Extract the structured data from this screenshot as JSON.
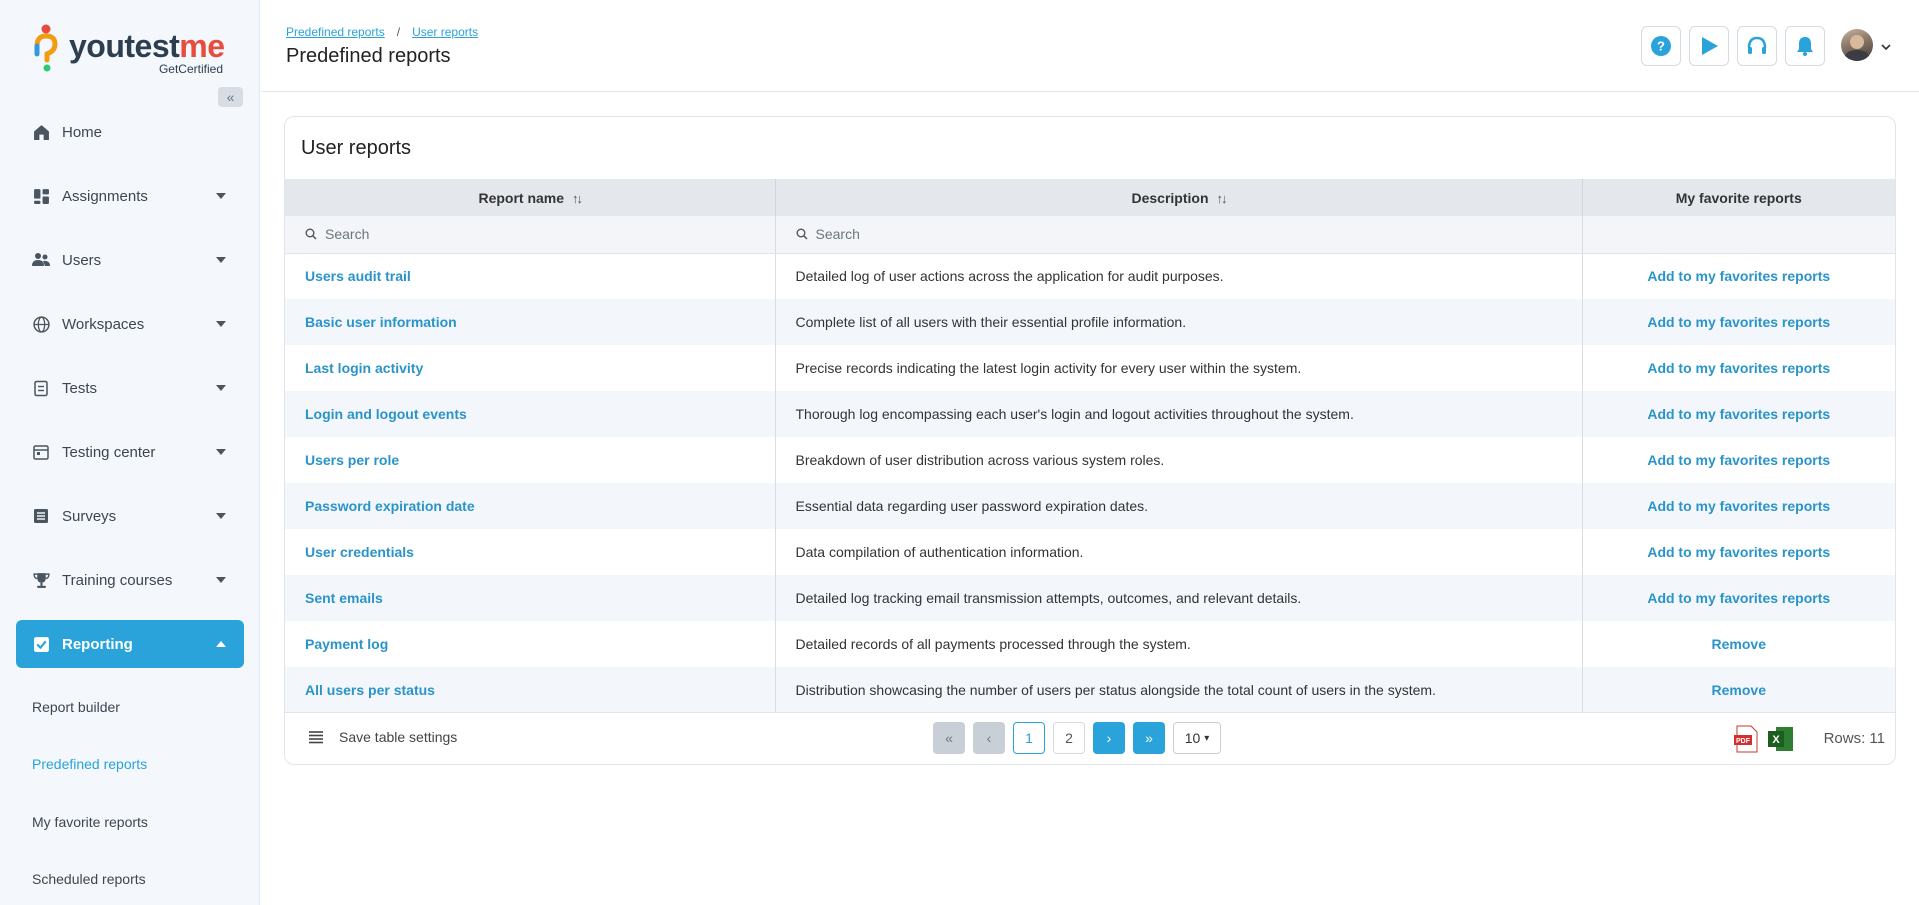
{
  "brand": {
    "name_main": "youtest",
    "name_accent": "me",
    "tagline": "GetCertified"
  },
  "sidebar": {
    "collapse_icon": "double-chevron-left-icon",
    "items": [
      {
        "label": "Home",
        "icon": "home-icon",
        "has_caret": false
      },
      {
        "label": "Assignments",
        "icon": "assignments-icon",
        "has_caret": true
      },
      {
        "label": "Users",
        "icon": "users-icon",
        "has_caret": true
      },
      {
        "label": "Workspaces",
        "icon": "globe-icon",
        "has_caret": true
      },
      {
        "label": "Tests",
        "icon": "tests-icon",
        "has_caret": true
      },
      {
        "label": "Testing center",
        "icon": "calendar-icon",
        "has_caret": true
      },
      {
        "label": "Surveys",
        "icon": "list-icon",
        "has_caret": true
      },
      {
        "label": "Training courses",
        "icon": "trophy-icon",
        "has_caret": true
      },
      {
        "label": "Reporting",
        "icon": "reporting-icon",
        "has_caret": true,
        "active": true
      }
    ],
    "sub_items": [
      {
        "label": "Report builder"
      },
      {
        "label": "Predefined reports",
        "active": true
      },
      {
        "label": "My favorite reports"
      },
      {
        "label": "Scheduled reports"
      }
    ]
  },
  "header": {
    "breadcrumb": [
      "Predefined reports",
      "User reports"
    ],
    "breadcrumb_sep": "/",
    "title": "Predefined reports",
    "buttons": [
      "help-icon",
      "play-icon",
      "headset-icon",
      "bell-icon"
    ],
    "accent_color": "#29a3da"
  },
  "card": {
    "title": "User reports",
    "columns": [
      {
        "label": "Report name",
        "sortable": true
      },
      {
        "label": "Description",
        "sortable": true
      },
      {
        "label": "My favorite reports",
        "sortable": false
      }
    ],
    "search_placeholder": "Search",
    "rows": [
      {
        "name": "Users audit trail",
        "description": "Detailed log of user actions across the application for audit purposes.",
        "action": "Add to my favorites reports"
      },
      {
        "name": "Basic user information",
        "description": "Complete list of all users with their essential profile information.",
        "action": "Add to my favorites reports"
      },
      {
        "name": "Last login activity",
        "description": "Precise records indicating the latest login activity for every user within the system.",
        "action": "Add to my favorites reports"
      },
      {
        "name": "Login and logout events",
        "description": "Thorough log encompassing each user's login and logout activities throughout the system.",
        "action": "Add to my favorites reports"
      },
      {
        "name": "Users per role",
        "description": "Breakdown of user distribution across various system roles.",
        "action": "Add to my favorites reports"
      },
      {
        "name": "Password expiration date",
        "description": "Essential data regarding user password expiration dates.",
        "action": "Add to my favorites reports"
      },
      {
        "name": "User credentials",
        "description": "Data compilation of authentication information.",
        "action": "Add to my favorites reports"
      },
      {
        "name": "Sent emails",
        "description": "Detailed log tracking email transmission attempts, outcomes, and relevant details.",
        "action": "Add to my favorites reports"
      },
      {
        "name": "Payment log",
        "description": "Detailed records of all payments processed through the system.",
        "action": "Remove"
      },
      {
        "name": "All users per status",
        "description": "Distribution showcasing the number of users per status alongside the total count of users in the system.",
        "action": "Remove"
      }
    ],
    "footer": {
      "save_settings": "Save table settings",
      "pages": [
        "1",
        "2"
      ],
      "current_page": "1",
      "page_size": "10",
      "rows_label": "Rows: 11",
      "exports": [
        "pdf-icon",
        "excel-icon"
      ]
    }
  }
}
